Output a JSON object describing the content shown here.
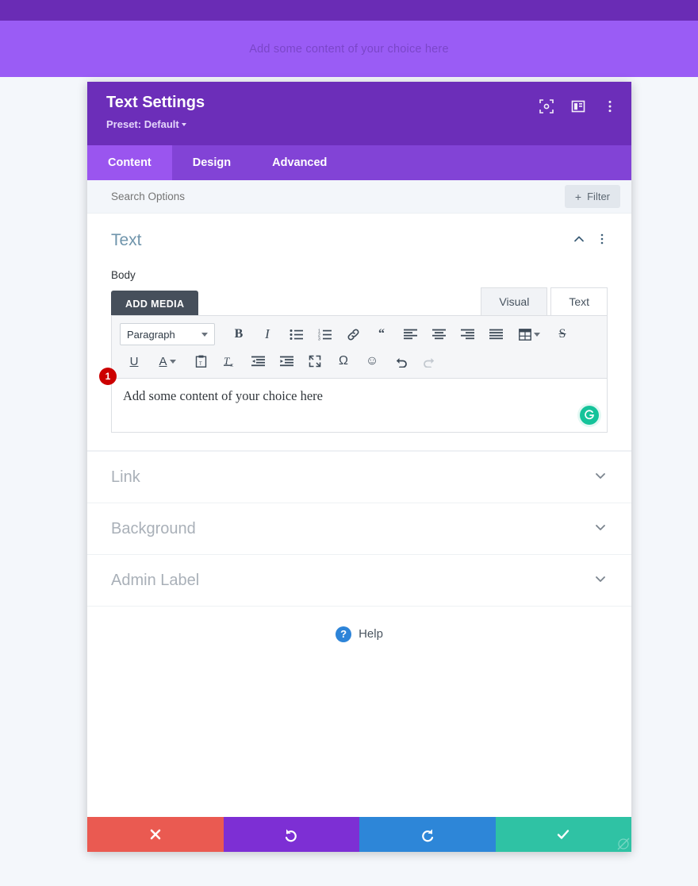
{
  "page": {
    "banner_text": "Add some content of your choice here",
    "band_dark_color": "#6a2cb5",
    "band_light_color": "#9a5cf5"
  },
  "modal": {
    "title": "Text Settings",
    "preset": "Preset: Default",
    "header_color": "#6c2eb9",
    "header_icons": [
      {
        "name": "focus-target-icon"
      },
      {
        "name": "layout-panel-icon"
      },
      {
        "name": "more-vertical-icon"
      }
    ],
    "tabs": [
      {
        "label": "Content",
        "active": true
      },
      {
        "label": "Design",
        "active": false
      },
      {
        "label": "Advanced",
        "active": false
      }
    ],
    "search": {
      "placeholder": "Search Options",
      "value": ""
    },
    "filter_button": {
      "label": "Filter",
      "plus": "+"
    }
  },
  "text_section": {
    "title": "Text",
    "field_label": "Body",
    "add_media_label": "ADD MEDIA",
    "editor_tabs": [
      {
        "label": "Visual",
        "active": true
      },
      {
        "label": "Text",
        "active": false
      }
    ],
    "toolbar_row1": [
      {
        "name": "paragraph-format-select",
        "label": "Paragraph",
        "type": "select"
      },
      {
        "name": "bold-button",
        "glyph": "B",
        "style": "bold"
      },
      {
        "name": "italic-button",
        "glyph": "I",
        "style": "italic"
      },
      {
        "name": "bullet-list-button",
        "glyph": "bullet-list",
        "style": "svg"
      },
      {
        "name": "numbered-list-button",
        "glyph": "numbered-list",
        "style": "svg"
      },
      {
        "name": "insert-link-button",
        "glyph": "link",
        "style": "svg"
      },
      {
        "name": "blockquote-button",
        "glyph": "“",
        "style": "quote"
      },
      {
        "name": "align-left-button",
        "glyph": "align-left",
        "style": "svg"
      },
      {
        "name": "align-center-button",
        "glyph": "align-center",
        "style": "svg"
      },
      {
        "name": "align-right-button",
        "glyph": "align-right",
        "style": "svg"
      },
      {
        "name": "align-justify-button",
        "glyph": "align-justify",
        "style": "svg"
      },
      {
        "name": "insert-table-button",
        "glyph": "table",
        "style": "svg-caret"
      },
      {
        "name": "strikethrough-button",
        "glyph": "S",
        "style": "strike"
      }
    ],
    "toolbar_row2": [
      {
        "name": "underline-button",
        "glyph": "U",
        "style": "underline"
      },
      {
        "name": "text-color-button",
        "glyph": "A",
        "style": "color-caret"
      },
      {
        "name": "paste-as-text-button",
        "glyph": "paste",
        "style": "svg"
      },
      {
        "name": "clear-formatting-button",
        "glyph": "clear-format",
        "style": "svg"
      },
      {
        "name": "outdent-button",
        "glyph": "outdent",
        "style": "svg"
      },
      {
        "name": "indent-button",
        "glyph": "indent",
        "style": "svg"
      },
      {
        "name": "fullscreen-button",
        "glyph": "fullscreen",
        "style": "svg"
      },
      {
        "name": "special-character-button",
        "glyph": "Ω",
        "style": "omega"
      },
      {
        "name": "emoji-button",
        "glyph": "☺",
        "style": "emoji"
      },
      {
        "name": "undo-button",
        "glyph": "undo",
        "style": "svg"
      },
      {
        "name": "redo-button",
        "glyph": "redo",
        "style": "svg-disabled"
      }
    ],
    "editor_content": "Add some content of your choice here",
    "marker_number": "1",
    "marker_color": "#cc0000",
    "grammar_badge": {
      "name": "grammarly-icon",
      "color": "#15c39a"
    }
  },
  "accordions": [
    {
      "label": "Link",
      "name": "accordion-link"
    },
    {
      "label": "Background",
      "name": "accordion-background"
    },
    {
      "label": "Admin Label",
      "name": "accordion-admin-label"
    }
  ],
  "help": {
    "label": "Help",
    "icon_glyph": "?",
    "icon_color": "#2d84d8"
  },
  "footer": {
    "buttons": [
      {
        "name": "cancel-button",
        "icon": "close-icon",
        "color": "#ea5a51"
      },
      {
        "name": "undo-button",
        "icon": "undo-icon",
        "color": "#7d2fd4"
      },
      {
        "name": "redo-button",
        "icon": "redo-icon",
        "color": "#2d86d8"
      },
      {
        "name": "save-button",
        "icon": "check-icon",
        "color": "#2fc2a4"
      }
    ]
  }
}
